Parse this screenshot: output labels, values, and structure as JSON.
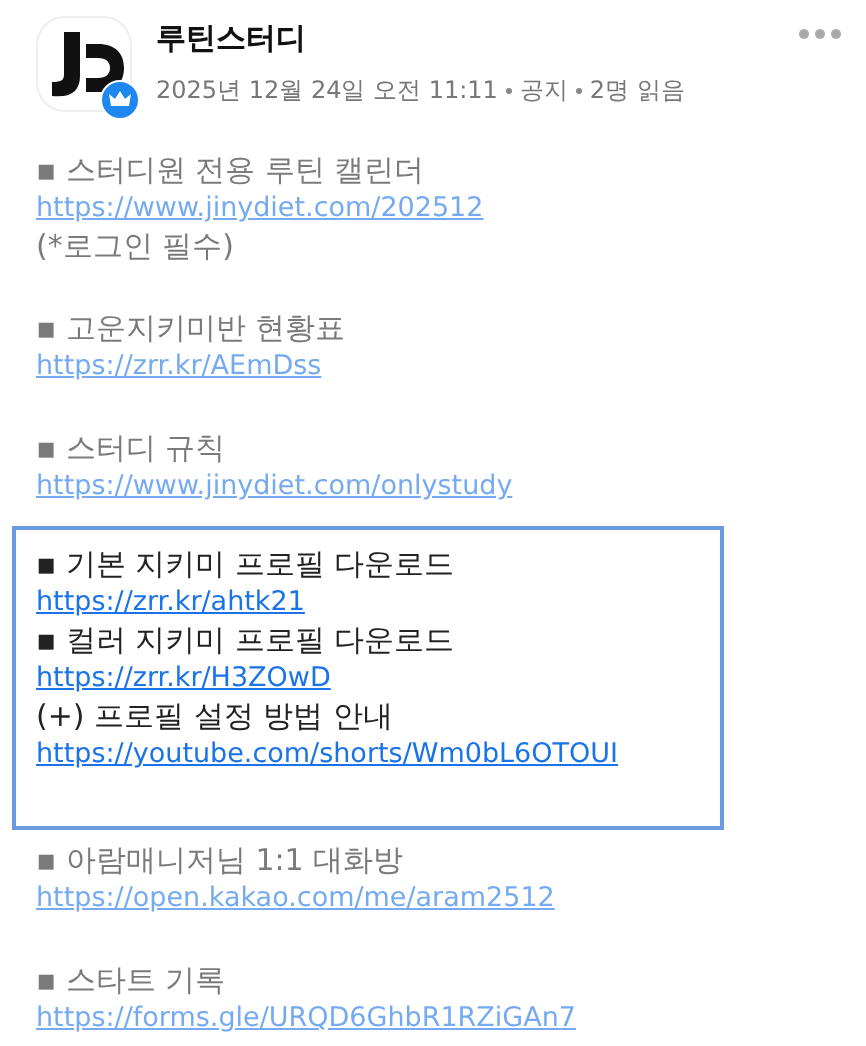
{
  "post": {
    "author": "루틴스터디",
    "meta": [
      "2025년 12월 24일 오전 11:11",
      "공지",
      "2명 읽음"
    ],
    "verified": true
  },
  "sections": [
    {
      "blurred": true,
      "highlighted": false,
      "lines": [
        {
          "kind": "text",
          "text": "▪ 스터디원 전용 루틴 캘린더"
        },
        {
          "kind": "link",
          "text": "https://www.jinydiet.com/202512"
        },
        {
          "kind": "text",
          "text": "(*로그인 필수)"
        }
      ]
    },
    {
      "blurred": true,
      "highlighted": false,
      "lines": [
        {
          "kind": "text",
          "text": "▪ 고운지키미반 현황표"
        },
        {
          "kind": "link",
          "text": "https://zrr.kr/AEmDss"
        }
      ]
    },
    {
      "blurred": true,
      "highlighted": false,
      "lines": [
        {
          "kind": "text",
          "text": "▪ 스터디 규칙"
        },
        {
          "kind": "link",
          "text": "https://www.jinydiet.com/onlystudy"
        }
      ]
    },
    {
      "blurred": false,
      "highlighted": true,
      "lines": [
        {
          "kind": "text",
          "text": "▪ 기본 지키미 프로필 다운로드"
        },
        {
          "kind": "link",
          "text": "https://zrr.kr/ahtk21"
        },
        {
          "kind": "text",
          "text": "▪ 컬러 지키미 프로필 다운로드"
        },
        {
          "kind": "link",
          "text": "https://zrr.kr/H3ZOwD"
        },
        {
          "kind": "text",
          "text": "(+) 프로필 설정 방법 안내"
        },
        {
          "kind": "link",
          "text": "https://youtube.com/shorts/Wm0bL6OTOUI"
        }
      ]
    },
    {
      "blurred": true,
      "highlighted": false,
      "lines": [
        {
          "kind": "text",
          "text": "▪ 아람매니저님 1:1 대화방"
        },
        {
          "kind": "link",
          "text": "https://open.kakao.com/me/aram2512"
        }
      ]
    },
    {
      "blurred": true,
      "highlighted": false,
      "lines": [
        {
          "kind": "text",
          "text": "▪ 스타트 기록"
        },
        {
          "kind": "link",
          "text": "https://forms.gle/URQD6GhbR1RZiGAn7"
        }
      ]
    }
  ]
}
